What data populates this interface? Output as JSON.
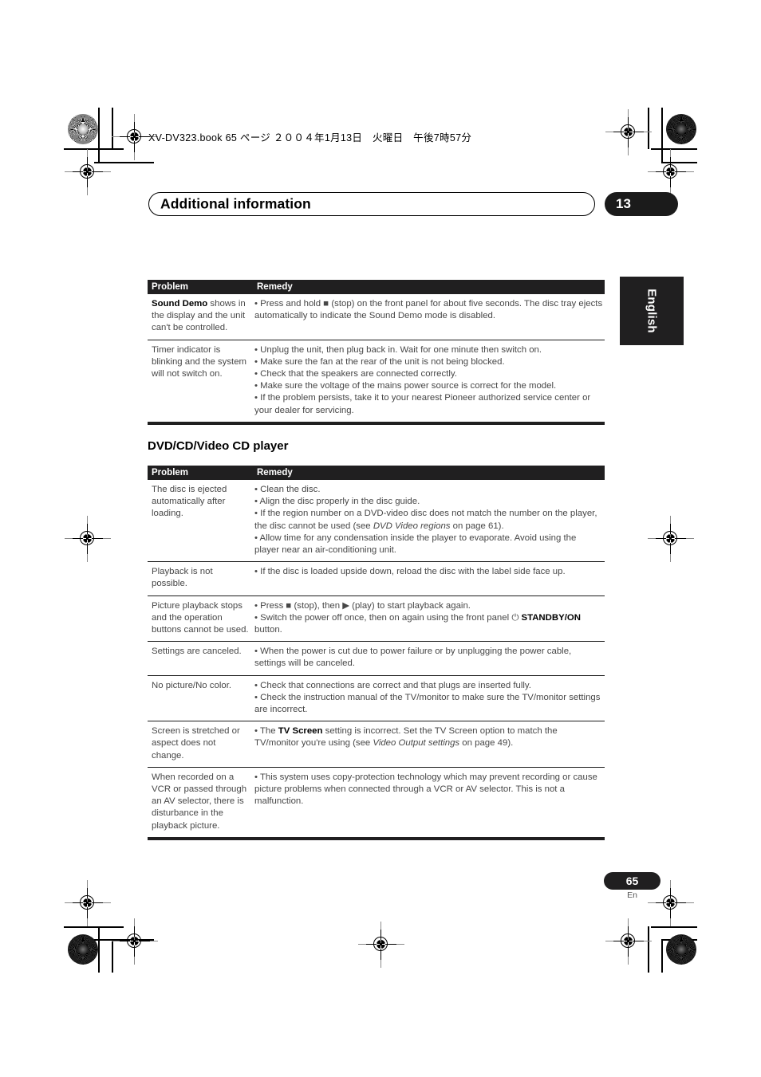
{
  "print_header": {
    "book_line": "XV-DV323.book  65 ページ  ２００４年1月13日　火曜日　午後7時57分"
  },
  "chapter": {
    "title": "Additional information",
    "number": "13"
  },
  "side_tab": {
    "language": "English"
  },
  "tables": [
    {
      "id": "general-troubleshooting",
      "headers": {
        "problem": "Problem",
        "remedy": "Remedy"
      },
      "rows": [
        {
          "problem_bold": "Sound Demo",
          "problem_rest": " shows in the display and the unit can't be controlled.",
          "remedy": "• Press and hold ■ (stop) on the front panel for about five seconds. The disc tray ejects automatically to indicate the Sound Demo mode is disabled."
        },
        {
          "problem_bold": "",
          "problem_rest": "Timer indicator is blinking and the system will not switch on.",
          "remedy_lines": [
            "• Unplug the unit, then plug back in. Wait for one minute then switch on.",
            "• Make sure the fan at the rear of the unit is not being blocked.",
            "• Check that the speakers are connected correctly.",
            "• Make sure the voltage of the mains power source is correct for the model.",
            "• If the problem persists, take it to your nearest Pioneer authorized service center or your dealer for servicing."
          ]
        }
      ]
    }
  ],
  "section_heading": "DVD/CD/Video CD player",
  "dvd_table": {
    "headers": {
      "problem": "Problem",
      "remedy": "Remedy"
    },
    "rows": [
      {
        "problem": "The disc is ejected automatically after loading.",
        "remedy_lines": [
          "• Clean the disc.",
          "• Align the disc properly in the disc guide.",
          "• If the region number on a DVD-video disc does not match the number on the player, the disc cannot be used (see DVD Video regions on page 61).",
          "• Allow time for any condensation inside the player to evaporate. Avoid using the player near an air-conditioning unit."
        ],
        "italic_ref": "DVD Video regions",
        "page_ref": "61"
      },
      {
        "problem": "Playback is not possible.",
        "remedy_lines": [
          "• If the disc is loaded upside down, reload the disc with the label side face up."
        ]
      },
      {
        "problem": "Picture playback stops and the operation buttons cannot be used.",
        "remedy_lines": [
          "• Press ■ (stop), then ▶ (play) to start playback again.",
          "• Switch the power off once, then on again using the front panel ⏻ STANDBY/ON button."
        ],
        "bold_term": "STANDBY/ON",
        "icon": "power-standby-icon"
      },
      {
        "problem": "Settings are canceled.",
        "remedy_lines": [
          "• When the power is cut due to power failure or by unplugging the power cable, settings will be canceled."
        ]
      },
      {
        "problem": "No picture/No color.",
        "remedy_lines": [
          "• Check that connections are correct and that plugs are inserted fully.",
          "• Check the instruction manual of the TV/monitor to make sure the TV/monitor settings are incorrect."
        ]
      },
      {
        "problem": "Screen is stretched or aspect does not change.",
        "remedy_lines": [
          "• The TV Screen setting is incorrect. Set the TV Screen option to match the TV/monitor you're using (see Video Output settings on page 49)."
        ],
        "bold_term": "TV Screen",
        "italic_ref": "Video Output settings",
        "page_ref": "49"
      },
      {
        "problem": "When recorded on a VCR or passed through an AV selector, there is disturbance in the playback picture.",
        "remedy_lines": [
          "• This system uses copy-protection technology which may prevent recording or cause picture problems when connected through a VCR or AV selector. This is not a malfunction."
        ]
      }
    ]
  },
  "footer": {
    "page_number": "65",
    "language_code": "En"
  },
  "colors": {
    "ink_black": "#201f20",
    "body_gray": "#474747",
    "paper": "#ffffff"
  }
}
